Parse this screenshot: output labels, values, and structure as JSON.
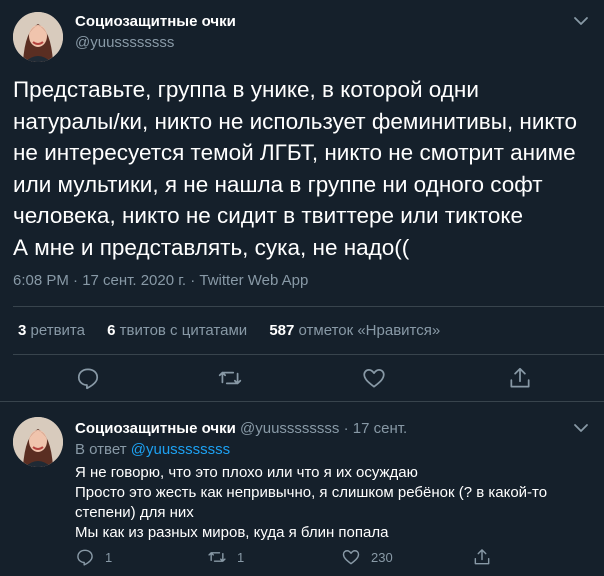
{
  "main_tweet": {
    "author_name": "Социозащитные очки",
    "handle": "@yuussssssss",
    "text_lines": [
      "Представьте, группа в унике, в которой одни",
      "натуралы/ки, никто не использует феминитивы, никто",
      "не интересуется темой ЛГБТ, никто не смотрит аниме",
      "или мультики, я не нашла в группе ни одного софт",
      "человека, никто не сидит в твиттере или тиктоке",
      "А мне и представлять, сука, не надо(("
    ],
    "timestamp": "6:08 PM · 17 сент. 2020 г. · Twitter Web App",
    "stats": {
      "retweets_count": "3",
      "retweets_label": "ретвита",
      "quotes_count": "6",
      "quotes_label": "твитов с цитатами",
      "likes_count": "587",
      "likes_label": "отметок «Нравится»"
    },
    "actions": [
      "reply-icon",
      "retweet-icon",
      "like-icon",
      "share-icon"
    ]
  },
  "reply_tweet": {
    "author_name": "Социозащитные очки",
    "handle_date": "@yuussssssss · 17 сент.",
    "reply_to_prefix": "В ответ",
    "reply_to_handle": "@yuussssssss",
    "text_lines": [
      "Я не говорю, что это плохо или что я их осуждаю",
      "Просто это жесть как непривычно, я слишком ребёнок (? в какой-то",
      "степени) для них",
      "Мы как из разных миров, куда я блин попала"
    ],
    "reply_count": "1",
    "retweet_count": "1",
    "like_count": "230"
  },
  "colors": {
    "background": "#15202b",
    "text": "#ffffff",
    "secondary": "#8899a6",
    "divider": "#38444d",
    "link": "#1da1f2"
  }
}
